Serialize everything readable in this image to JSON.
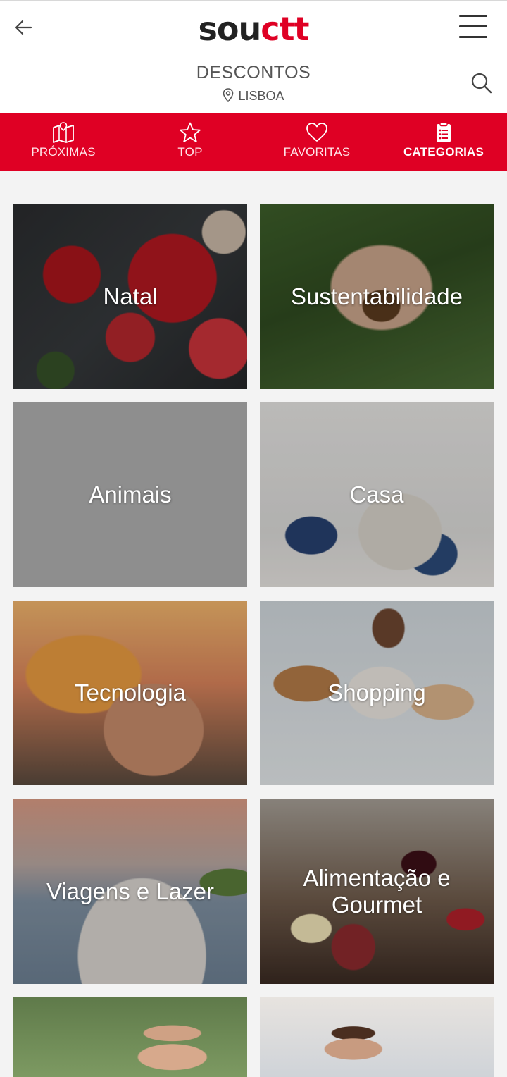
{
  "header": {
    "logo_part1": "sou",
    "logo_part2": "ctt",
    "title": "DESCONTOS",
    "location": "LISBOA",
    "brand_color": "#df0024"
  },
  "tabs": [
    {
      "label": "PRÓXIMAS",
      "icon": "map-icon",
      "active": false
    },
    {
      "label": "TOP",
      "icon": "star-icon",
      "active": false
    },
    {
      "label": "FAVORITAS",
      "icon": "heart-icon",
      "active": false
    },
    {
      "label": "CATEGORIAS",
      "icon": "clipboard-list-icon",
      "active": true
    }
  ],
  "categories": [
    {
      "label": "Natal"
    },
    {
      "label": "Sustentabilidade"
    },
    {
      "label": "Animais"
    },
    {
      "label": "Casa"
    },
    {
      "label": "Tecnologia"
    },
    {
      "label": "Shopping"
    },
    {
      "label": "Viagens e Lazer"
    },
    {
      "label": "Alimentação e Gourmet"
    },
    {
      "label": ""
    },
    {
      "label": ""
    }
  ]
}
